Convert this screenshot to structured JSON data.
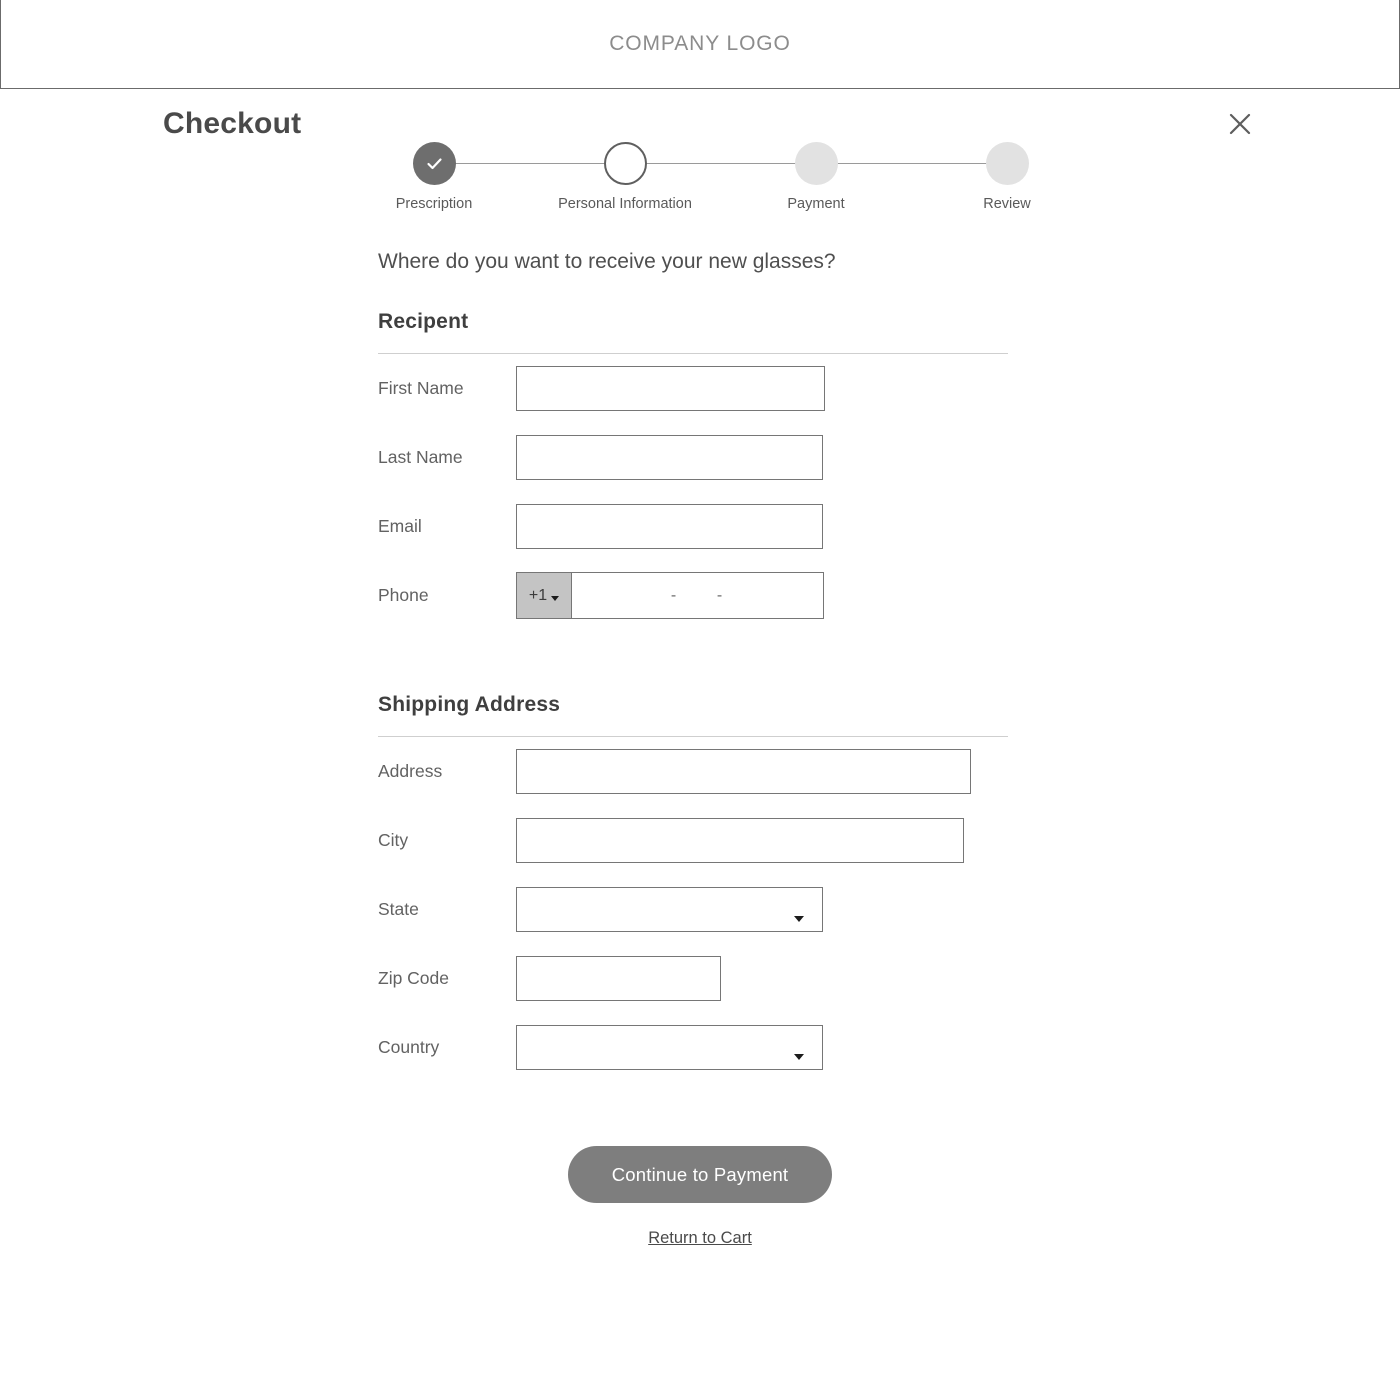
{
  "brandbar": {
    "logo": "COMPANY LOGO"
  },
  "header": {
    "title": "Checkout",
    "close_icon": "close-icon"
  },
  "stepper": {
    "steps": [
      {
        "label": "Prescription",
        "state": "done"
      },
      {
        "label": "Personal Information",
        "state": "current"
      },
      {
        "label": "Payment",
        "state": "upcoming"
      },
      {
        "label": "Review",
        "state": "upcoming"
      }
    ]
  },
  "form": {
    "lead_question": "Where do you want to receive your new glasses?",
    "recipient": {
      "heading": "Recipent",
      "fields": {
        "first_name": {
          "label": "First Name",
          "value": "",
          "placeholder": ""
        },
        "last_name": {
          "label": "Last Name",
          "value": "",
          "placeholder": ""
        },
        "email": {
          "label": "Email",
          "value": "",
          "placeholder": ""
        },
        "phone": {
          "label": "Phone",
          "country_code": "+1",
          "value": "",
          "placeholder": "-      -"
        }
      }
    },
    "shipping": {
      "heading": "Shipping Address",
      "fields": {
        "address": {
          "label": "Address",
          "value": "",
          "placeholder": ""
        },
        "city": {
          "label": "City",
          "value": "",
          "placeholder": ""
        },
        "state": {
          "label": "State",
          "value": ""
        },
        "zip_code": {
          "label": "Zip Code",
          "value": "",
          "placeholder": ""
        },
        "country": {
          "label": "Country",
          "value": ""
        }
      }
    }
  },
  "actions": {
    "primary_label": "Continue to Payment",
    "return_link_label": "Return to Cart"
  },
  "colors": {
    "accent": "#7e7e7e",
    "step_done": "#6e6e6e",
    "step_upcoming": "#e2e2e2",
    "border": "#767676",
    "text": "#4a4a4a"
  }
}
